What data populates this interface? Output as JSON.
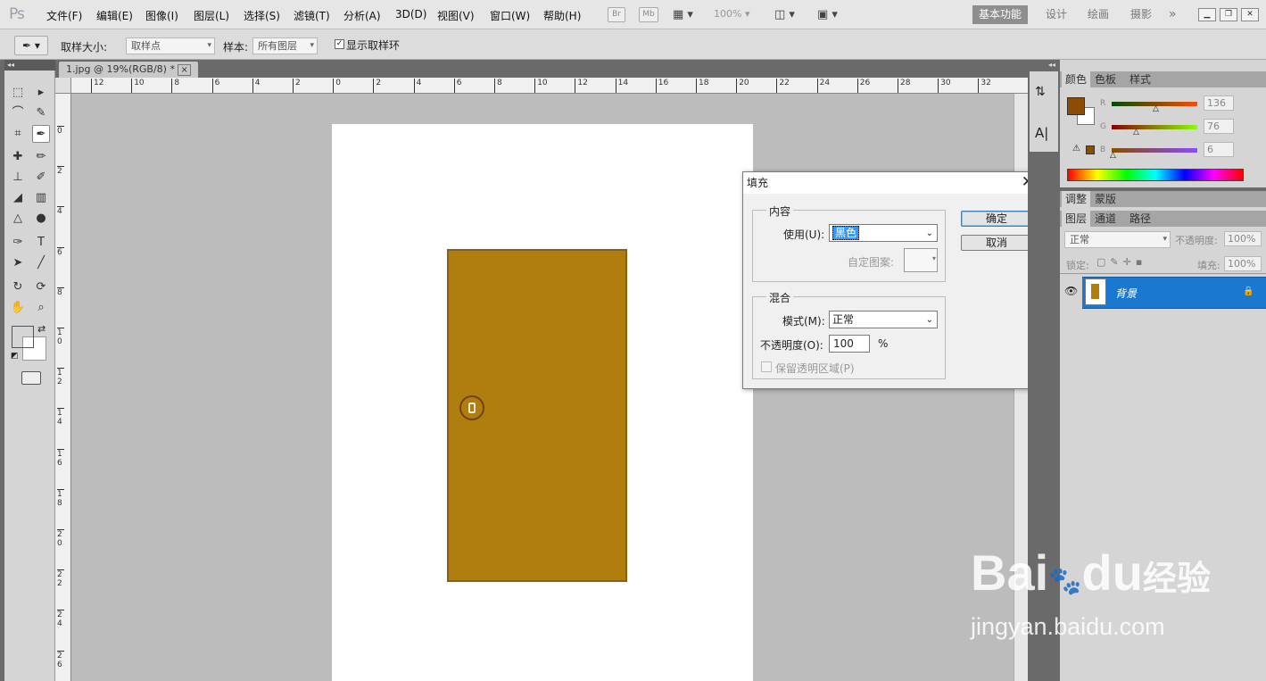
{
  "app": {
    "logo": "Ps"
  },
  "menu": [
    "文件(F)",
    "编辑(E)",
    "图像(I)",
    "图层(L)",
    "选择(S)",
    "滤镜(T)",
    "分析(A)",
    "3D(D)",
    "视图(V)",
    "窗口(W)",
    "帮助(H)"
  ],
  "menu_tools": {
    "br": "Br",
    "mb": "Mb",
    "zoom": "100%"
  },
  "workspace": {
    "basic": "基本功能",
    "design": "设计",
    "paint": "绘画",
    "photo": "摄影",
    "more": "»"
  },
  "options": {
    "sample_size_label": "取样大小:",
    "sample_size_value": "取样点",
    "sample_label": "样本:",
    "sample_value": "所有图层",
    "show_ring_label": "显示取样环"
  },
  "document": {
    "tab_title": "1.jpg @ 19%(RGB/8) *",
    "tab_close": "×"
  },
  "ruler": {
    "h_ticks": [
      "12",
      "10",
      "8",
      "6",
      "4",
      "2",
      "0",
      "2",
      "4",
      "6",
      "8",
      "10",
      "12",
      "14",
      "16",
      "18",
      "20",
      "22",
      "24",
      "26",
      "28",
      "30",
      "32"
    ],
    "v_ticks": [
      "0",
      "2",
      "4",
      "6",
      "8",
      "10",
      "12",
      "14",
      "16",
      "18",
      "20",
      "22",
      "24",
      "26"
    ]
  },
  "colors": {
    "foreground": "#8b4c06",
    "door": "#b07d0f",
    "accent": "#1a78d0"
  },
  "fill_dialog": {
    "title": "填充",
    "content_legend": "内容",
    "use_label": "使用(U):",
    "use_value": "黑色",
    "custom_pattern_label": "自定图案:",
    "blend_legend": "混合",
    "mode_label": "模式(M):",
    "mode_value": "正常",
    "opacity_label": "不透明度(O):",
    "opacity_value": "100",
    "opacity_unit": "%",
    "preserve_label": "保留透明区域(P)",
    "ok": "确定",
    "cancel": "取消"
  },
  "color_panel": {
    "tabs": [
      "颜色",
      "色板",
      "样式"
    ],
    "r_label": "R",
    "g_label": "G",
    "b_label": "B",
    "r": "136",
    "g": "76",
    "b": "6"
  },
  "adjust_panel": {
    "tabs": [
      "调整",
      "蒙版"
    ]
  },
  "layers_panel": {
    "tabs": [
      "图层",
      "通道",
      "路径"
    ],
    "blend_mode": "正常",
    "opacity_label": "不透明度:",
    "opacity": "100%",
    "lock_label": "锁定:",
    "fill_label": "填充:",
    "fill": "100%",
    "layer_name": "背景"
  },
  "watermark": {
    "brand": "Bai",
    "brand2": "du",
    "site_cn": "经验",
    "url": "jingyan.baidu.com"
  }
}
